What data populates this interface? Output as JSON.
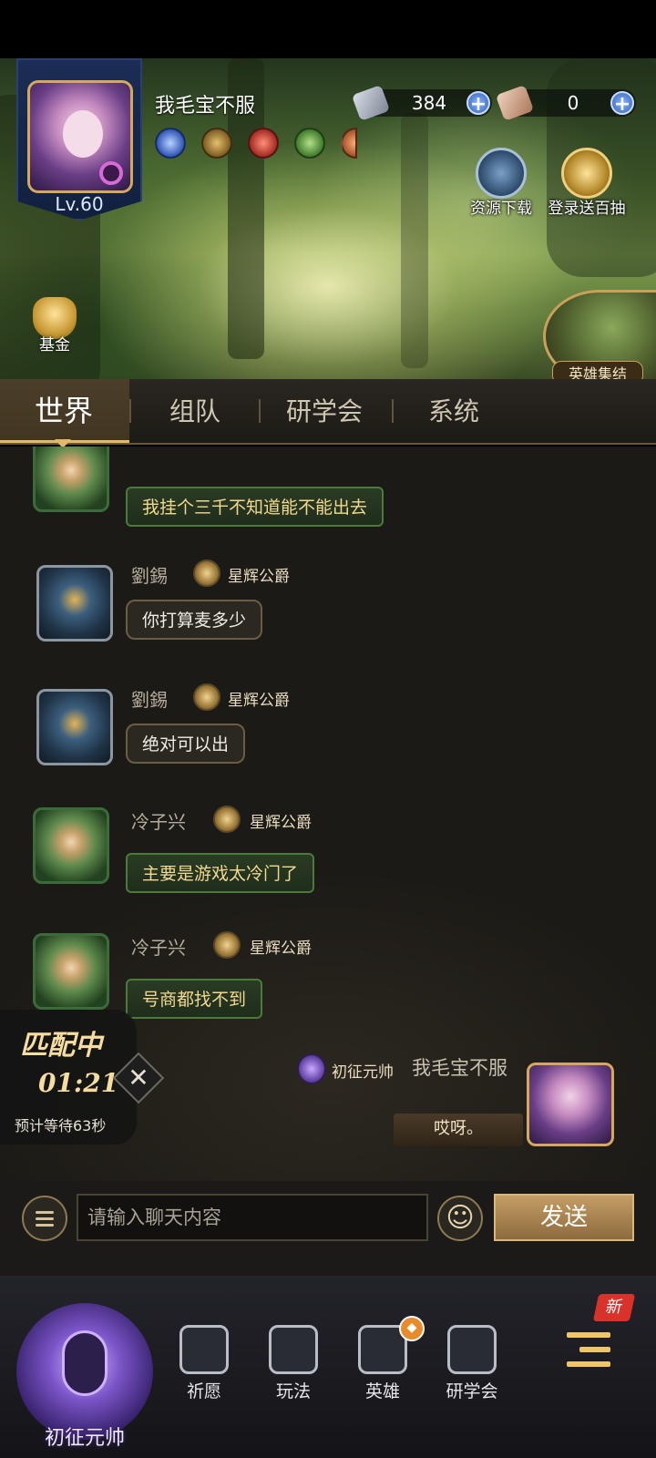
{
  "player": {
    "name": "我毛宝不服",
    "level": "Lv.60"
  },
  "currencies": [
    {
      "icon": "gem-tablet-icon",
      "value": "384"
    },
    {
      "icon": "scroll-icon",
      "value": "0"
    }
  ],
  "banner_buttons": {
    "resource_download": "资源下载",
    "login_gift": "登录送百抽",
    "fund": "基金",
    "hero_gather": "英雄集结"
  },
  "tabs": [
    "世界",
    "组队",
    "研学会",
    "系统"
  ],
  "messages": [
    {
      "name": "",
      "title": "",
      "text": "我挂个三千不知道能不能出去",
      "style": "green"
    },
    {
      "name": "劉錫",
      "title": "星辉公爵",
      "text": "你打算麦多少",
      "style": "plain"
    },
    {
      "name": "劉錫",
      "title": "星辉公爵",
      "text": "绝对可以出",
      "style": "plain"
    },
    {
      "name": "冷子兴",
      "title": "星辉公爵",
      "text": "主要是游戏太冷门了",
      "style": "green"
    },
    {
      "name": "冷子兴",
      "title": "星辉公爵",
      "text": "号商都找不到",
      "style": "green"
    }
  ],
  "matching": {
    "title": "匹配中",
    "time": "01:21",
    "estimate": "预计等待63秒",
    "close": "✕"
  },
  "own_message": {
    "rank": "初征元帅",
    "name": "我毛宝不服",
    "text": "哎呀。"
  },
  "input": {
    "placeholder": "请输入聊天内容",
    "send": "发送",
    "emoji": "☺"
  },
  "bottom_nav": {
    "rank": "初征元帅",
    "items": [
      "祈愿",
      "玩法",
      "英雄",
      "研学会"
    ],
    "new_tag": "新"
  },
  "colors": {
    "accent_gold": "#e0b96b",
    "bubble_green_text": "#f2d98e",
    "send_button": "#b28a55"
  }
}
